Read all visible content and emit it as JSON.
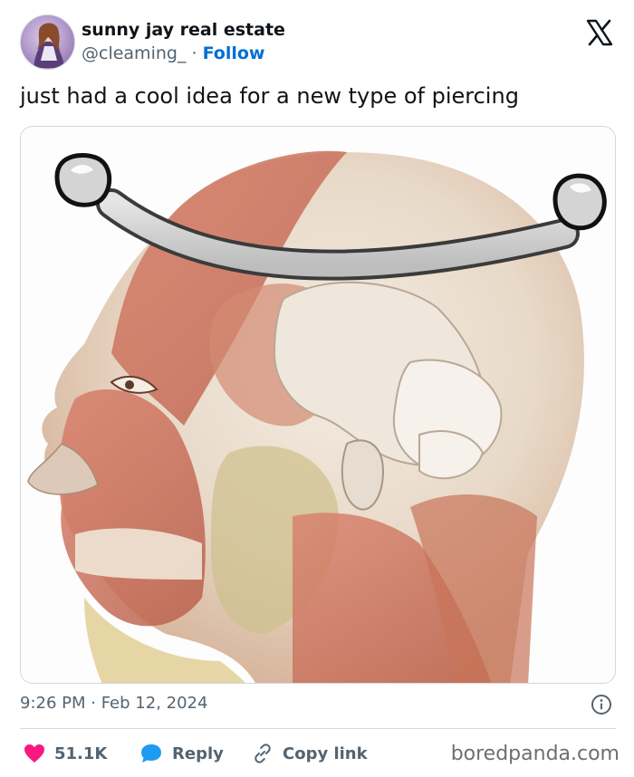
{
  "tweet": {
    "author_name": "sunny jay real estate",
    "handle": "@cleaming_",
    "separator": " · ",
    "follow_label": "Follow",
    "text": "just had a cool idea for a new type of piercing",
    "timestamp": "9:26 PM · Feb 12, 2024",
    "likes": "51.1K",
    "reply_label": "Reply",
    "copy_link_label": "Copy link"
  },
  "watermark": "boredpanda.com",
  "icons": {
    "logo": "x-logo-icon",
    "info": "info-icon",
    "like": "heart-icon",
    "reply": "speech-bubble-icon",
    "copy": "link-icon"
  },
  "colors": {
    "like": "#f91880",
    "reply": "#1d9bf0",
    "follow": "#006fd6",
    "muted": "#536471"
  }
}
